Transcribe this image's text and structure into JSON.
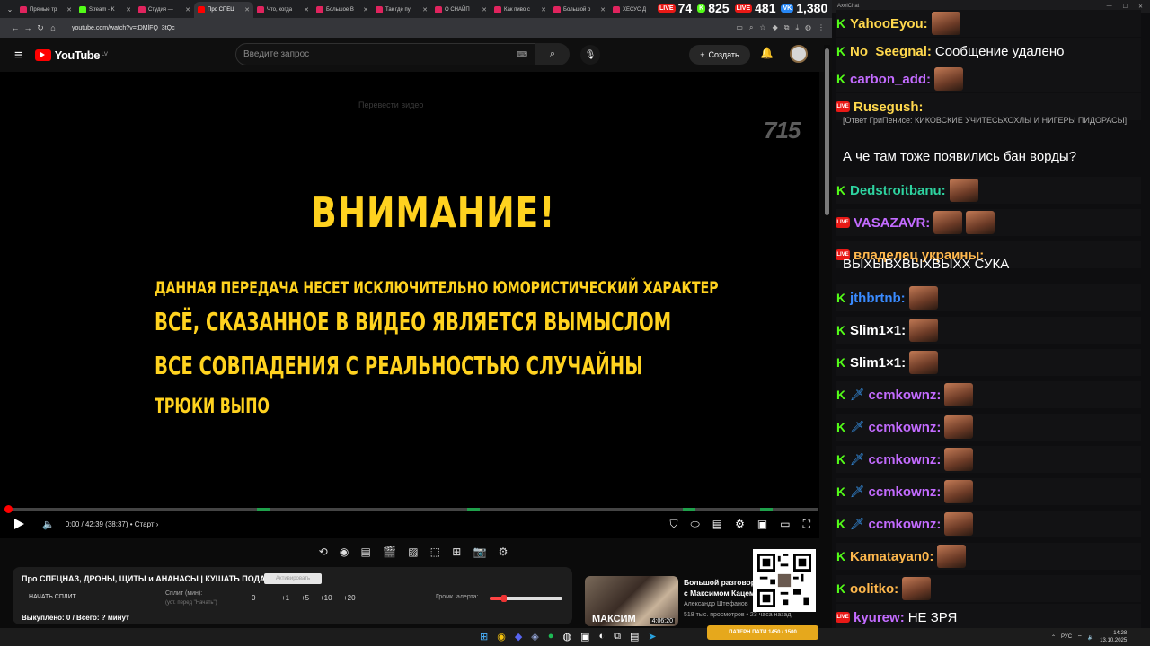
{
  "browser": {
    "tabs": [
      {
        "label": "Прямые тр",
        "color": "#e0245e"
      },
      {
        "label": "Stream - K",
        "color": "#53fc18"
      },
      {
        "label": "Студия — ",
        "color": "#e0245e"
      },
      {
        "label": "Про СПЕЦ",
        "color": "#ff0000",
        "active": true
      },
      {
        "label": "Что, когда",
        "color": "#e0245e"
      },
      {
        "label": "Большое В",
        "color": "#e0245e"
      },
      {
        "label": "Так где пу",
        "color": "#e0245e"
      },
      {
        "label": "О СНАЙП",
        "color": "#e0245e"
      },
      {
        "label": "Как пиво с",
        "color": "#e0245e"
      },
      {
        "label": "Большой р",
        "color": "#e0245e"
      },
      {
        "label": "ХЕСУС Д",
        "color": "#e0245e"
      }
    ],
    "url": "youtube.com/watch?v=tDMlFQ_3tQc"
  },
  "counters": [
    {
      "badge": "LIVE",
      "badge_color": "#e91916",
      "value": "74"
    },
    {
      "badge": "K",
      "badge_color": "#53fc18",
      "value": "825"
    },
    {
      "badge": "LIVE",
      "badge_color": "#e91916",
      "value": "481"
    },
    {
      "badge": "VK",
      "badge_color": "#2787f5",
      "value": "1,380"
    }
  ],
  "youtube": {
    "logo": "YouTube",
    "region": "LV",
    "search_placeholder": "Введите запрос",
    "create_label": "Создать"
  },
  "video": {
    "translate_hint": "Перевести видео",
    "channel_mark": "715",
    "heading": "ВНИМАНИЕ!",
    "lines": [
      "ДАННАЯ ПЕРЕДАЧА НЕСЕТ ИСКЛЮЧИТЕЛЬНО ЮМОРИСТИЧЕСКИЙ ХАРАКТЕР",
      "ВСЁ, СКАЗАННОЕ В ВИДЕО ЯВЛЯЕТСЯ ВЫМЫСЛОМ",
      "ВСЕ СОВПАДЕНИЯ С РЕАЛЬНОСТЬЮ СЛУЧАЙНЫ",
      "ТРЮКИ ВЫПО"
    ],
    "time": "0:00 / 42:39 (38:37) • Старт ›",
    "progress_fraction": 0.0
  },
  "panel": {
    "title": "Про СПЕЦНАЗ, ДРОНЫ, ЩИТЫ и АНАНАСЫ | КУШАТЬ ПОДАНО!",
    "button": "Активировать",
    "split_label": "НАЧАТЬ СПЛИТ",
    "split_min": "Сплит (мин):",
    "split_hint": "(уст. перед \"Начать\")",
    "nums": [
      "0",
      "+1",
      "+5",
      "+10",
      "+20"
    ],
    "alert_label": "Громк. алерта:",
    "alert_level": 0.2,
    "bought": "Выкуплено: 0 / Всего: ? минут"
  },
  "recommendation": {
    "title": "Большой разговор с Максимом Кацем",
    "author": "Александр Штефанов",
    "views": "518 тыс. просмотров • 23 часа назад",
    "thumb_text": "МАКСИМ",
    "duration": "4:06:20"
  },
  "chat": {
    "window_title": "AxelChat",
    "messages": [
      {
        "platform": "kick",
        "user": "YahooEyou:",
        "color": "#ffd84d",
        "text": "",
        "emote": true
      },
      {
        "platform": "kick",
        "user": "No_Seegnal:",
        "color": "#ffd84d",
        "text": "Сообщение удалено",
        "emote": false
      },
      {
        "platform": "kick",
        "user": "carbon_add:",
        "color": "#c36bff",
        "text": "",
        "emote": true
      },
      {
        "platform": "live",
        "user": "Rusegush:",
        "color": "#ffd84d",
        "text": "",
        "emote": false
      },
      {
        "platform": "kick",
        "user": "Dedstroitbanu:",
        "color": "#2ed3a0",
        "text": "",
        "emote": true
      },
      {
        "platform": "live",
        "user": "VASAZAVR:",
        "color": "#c36bff",
        "text": "",
        "emote": true
      },
      {
        "platform": "live",
        "user": "владелец украины:",
        "color": "#ffb84d",
        "text": "",
        "emote": false
      },
      {
        "platform": "kick",
        "user": "jthbrtnb:",
        "color": "#3a8bff",
        "text": "",
        "emote": true
      },
      {
        "platform": "kick",
        "user": "Slim1×1:",
        "color": "#ffffff",
        "text": "",
        "emote": true
      },
      {
        "platform": "kick",
        "user": "Slim1×1:",
        "color": "#ffffff",
        "text": "",
        "emote": true
      },
      {
        "platform": "kick",
        "user": "ccmkownz:",
        "color": "#c36bff",
        "text": "",
        "emote": true,
        "sword": true
      },
      {
        "platform": "kick",
        "user": "ccmkownz:",
        "color": "#c36bff",
        "text": "",
        "emote": true,
        "sword": true
      },
      {
        "platform": "kick",
        "user": "ccmkownz:",
        "color": "#c36bff",
        "text": "",
        "emote": true,
        "sword": true
      },
      {
        "platform": "kick",
        "user": "ccmkownz:",
        "color": "#c36bff",
        "text": "",
        "emote": true,
        "sword": true
      },
      {
        "platform": "kick",
        "user": "ccmkownz:",
        "color": "#c36bff",
        "text": "",
        "emote": true,
        "sword": true
      },
      {
        "platform": "kick",
        "user": "Kamatayan0:",
        "color": "#ffb84d",
        "text": "",
        "emote": true
      },
      {
        "platform": "kick",
        "user": "oolitko:",
        "color": "#ffb84d",
        "text": "",
        "emote": true
      },
      {
        "platform": "live",
        "user": "kyurew:",
        "color": "#c36bff",
        "text": "НЕ ЗРЯ",
        "emote": false
      }
    ],
    "reply": "[Ответ ГриПенисе: КИКОВСКИЕ УЧИТЕСЬХОХЛЫ И НИГЕРЫ ПИДОРАСЫ]",
    "rusegush_text": "А че там тоже появились бан ворды?",
    "vladelec_text": "ВЫХЫВХВЫХВЫХХ СУКА"
  },
  "taskbar": {
    "lang": "РУС",
    "time": "14:28",
    "date": "13.10.2025",
    "alert_bar": "ПАТЕРН ПАТИ 1450 / 1500"
  }
}
